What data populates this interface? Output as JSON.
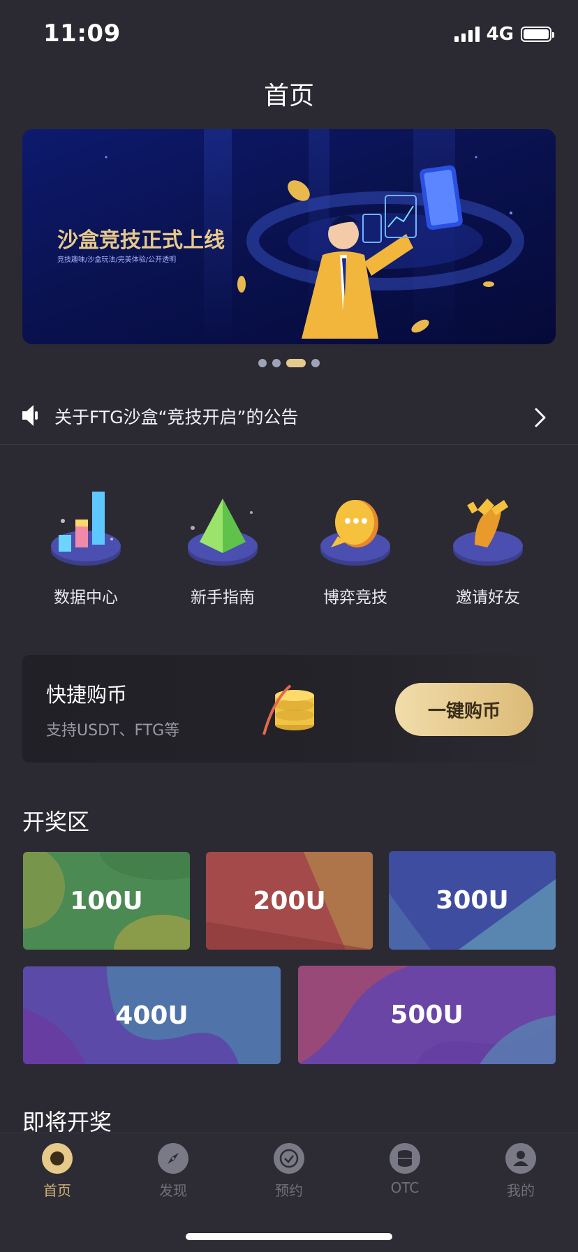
{
  "status_bar": {
    "time": "11:09",
    "network": "4G"
  },
  "header": {
    "title": "首页"
  },
  "banner": {
    "title": "沙盒竞技正式上线",
    "subtitle": "竞技趣味/沙盒玩法/完美体验/公开透明",
    "pages": 4,
    "active_page": 3
  },
  "notice": {
    "text": "关于FTG沙盒“竞技开启”的公告"
  },
  "quick_menu": [
    {
      "label": "数据中心",
      "icon": "bar-chart-icon"
    },
    {
      "label": "新手指南",
      "icon": "pyramid-icon"
    },
    {
      "label": "博弈竞技",
      "icon": "chat-bubble-icon"
    },
    {
      "label": "邀请好友",
      "icon": "handshake-icon"
    }
  ],
  "quick_buy": {
    "title": "快捷购币",
    "subtitle": "支持USDT、FTG等",
    "button": "一键购币"
  },
  "lottery": {
    "title": "开奖区",
    "tiles": [
      {
        "label": "100U",
        "color": "#4b8a52"
      },
      {
        "label": "200U",
        "color": "#a44a4a"
      },
      {
        "label": "300U",
        "color": "#4a66a8"
      },
      {
        "label": "400U",
        "color": "#5b4aa8"
      },
      {
        "label": "500U",
        "color": "#6a45a6"
      }
    ]
  },
  "upcoming": {
    "title": "即将开奖"
  },
  "tabbar": [
    {
      "label": "首页",
      "icon": "home-icon"
    },
    {
      "label": "发现",
      "icon": "compass-icon"
    },
    {
      "label": "预约",
      "icon": "check-circle-icon"
    },
    {
      "label": "OTC",
      "icon": "coins-stack-icon"
    },
    {
      "label": "我的",
      "icon": "user-icon"
    }
  ],
  "accent_color": "#e6c98c"
}
